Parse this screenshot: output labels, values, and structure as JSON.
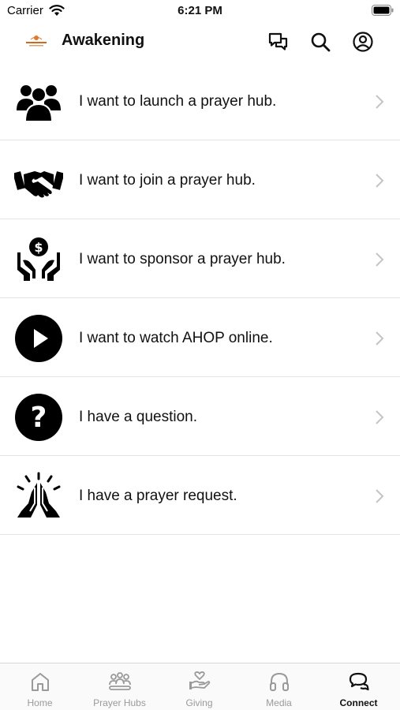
{
  "status_bar": {
    "carrier": "Carrier",
    "time": "6:21 PM"
  },
  "header": {
    "title": "Awakening",
    "logo_icon": "awakening-logo",
    "actions": [
      {
        "icon": "chat-bubbles-icon"
      },
      {
        "icon": "search-icon"
      },
      {
        "icon": "user-profile-icon"
      }
    ]
  },
  "connect_options": [
    {
      "icon": "people-group-icon",
      "label": "I want to launch a prayer hub."
    },
    {
      "icon": "handshake-icon",
      "label": "I want to join a prayer hub."
    },
    {
      "icon": "hands-dollar-icon",
      "label": "I want to sponsor a prayer hub."
    },
    {
      "icon": "play-circle-icon",
      "label": "I want to watch AHOP online."
    },
    {
      "icon": "question-circle-icon",
      "label": "I have a question."
    },
    {
      "icon": "praying-hands-icon",
      "label": "I have a prayer request."
    }
  ],
  "tabs": [
    {
      "icon": "home-icon",
      "label": "Home",
      "active": false
    },
    {
      "icon": "prayer-hubs-icon",
      "label": "Prayer Hubs",
      "active": false
    },
    {
      "icon": "giving-hand-heart-icon",
      "label": "Giving",
      "active": false
    },
    {
      "icon": "headphones-icon",
      "label": "Media",
      "active": false
    },
    {
      "icon": "chat-bubbles-icon",
      "label": "Connect",
      "active": true
    }
  ],
  "colors": {
    "accent": "#000000",
    "inactive_tab": "#9a9a9a",
    "logo": "#e07a2c",
    "divider": "#e4e4e4"
  }
}
